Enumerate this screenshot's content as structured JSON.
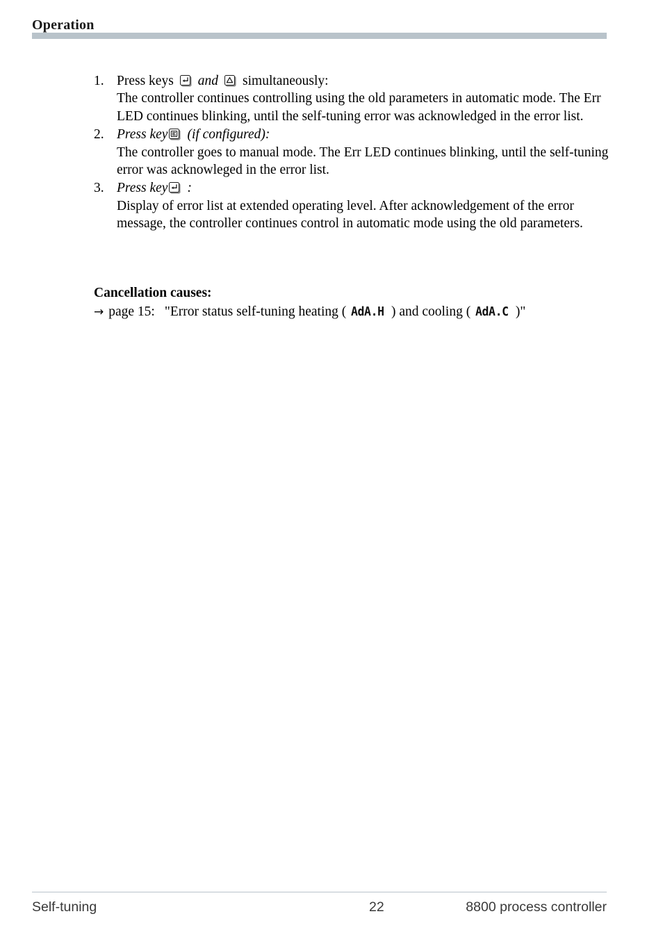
{
  "header": {
    "title": "Operation",
    "rule_color": "#b9c3ca"
  },
  "steps": [
    {
      "number": "1.",
      "lead_prefix": "Press keys",
      "lead_icon_1": "enter-key-icon",
      "lead_middle": "and",
      "lead_icon_2": "up-arrow-key-icon",
      "lead_suffix": "simultaneously:",
      "lead_italic": false,
      "text": "The controller continues controlling using the old parameters in automatic mode. The Err LED continues blinking, until the self-tuning error was acknowledged in the error list."
    },
    {
      "number": "2.",
      "lead_prefix": "Press key",
      "lead_icon_1": "manual-key-icon",
      "lead_suffix": "(if configured):",
      "lead_italic": true,
      "text": "The controller goes to manual mode. The Err LED continues blinking, until the self-tuning error was acknowleged in the error list."
    },
    {
      "number": "3.",
      "lead_prefix": "Press key",
      "lead_icon_1": "enter-key-icon",
      "lead_suffix": ":",
      "lead_italic": true,
      "text": "Display of error list at extended operating level. After acknowledgement of the error message, the controller continues control in automatic mode using the old parameters."
    }
  ],
  "cancellation": {
    "title": "Cancellation causes:",
    "arrow": "→",
    "reference": "page 15:",
    "quote_open": "\"Error status self-tuning heating (",
    "code_heating": "AdA.H",
    "middle": ") and cooling (",
    "code_cooling": "AdA.C",
    "quote_close": ")\""
  },
  "footer": {
    "left": "Self-tuning",
    "page": "22",
    "right": "8800 process controller"
  }
}
